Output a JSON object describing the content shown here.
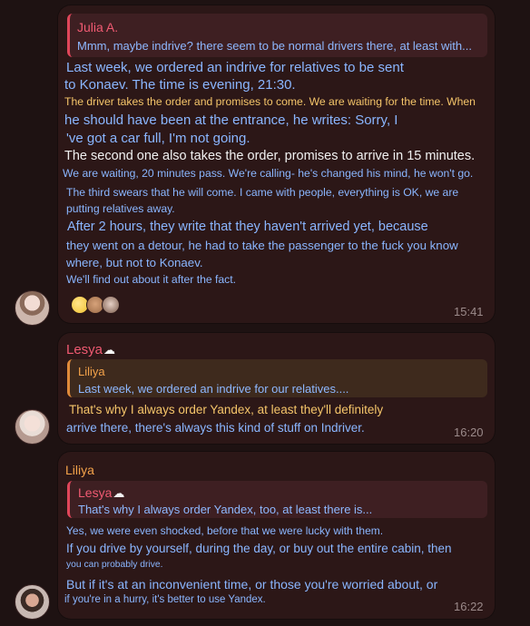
{
  "messages": [
    {
      "reply": {
        "author": "Julia A.",
        "text": "Mmm, maybe indrive? there seem to be normal drivers there, at least with..."
      },
      "lines": [
        "Last week, we ordered an indrive for relatives to be sent",
        "to Konaev. The time is evening, 21:30.",
        "The driver takes the order and promises to come. We are waiting for the time. When",
        "he should have been at the entrance, he writes: Sorry, I",
        "'ve got a car full, I'm not going.",
        "The second one also takes the order, promises to arrive in 15 minutes.",
        "We are waiting, 20 minutes pass. We're calling- he's changed his mind, he won't go.",
        "The third swears that he will come. I came with people, everything is OK, we are",
        "putting relatives away.",
        "After 2 hours, they write that they haven't arrived yet, because",
        "they went on a detour, he had to take the passenger to the fuck you know",
        "where, but not to Konaev.",
        "We'll find out about it after the fact."
      ],
      "reactions": [
        "slightly-smiling-face-icon",
        "dog-avatar-icon",
        "user-avatar-icon"
      ],
      "time": "15:41"
    },
    {
      "sender": "Lesya",
      "sender_emoji": "☁",
      "reply": {
        "author": "Liliya",
        "text": "Last week, we ordered an indrive for our relatives...."
      },
      "lines": [
        "That's why I always order Yandex, at least they'll definitely",
        "arrive there, there's always this kind of stuff on Indriver."
      ],
      "time": "16:20"
    },
    {
      "sender": "Liliya",
      "reply": {
        "author": "Lesya",
        "author_emoji": "☁",
        "text": "That's why I always order Yandex, too, at least there is..."
      },
      "lines": [
        "Yes, we were even shocked, before that we were lucky with them.",
        "If you drive by yourself, during the day, or buy out the entire cabin, then",
        "you can probably drive.",
        "But if it's at an inconvenient time, or those you're worried about, or",
        "if you're in a hurry, it's better to use Yandex."
      ],
      "time": "16:22"
    }
  ],
  "colors": {
    "background": "#1e1212",
    "bubble": "#2c1717",
    "accent_red": "#e0465a",
    "accent_orange": "#e08a3a",
    "text_blue": "#8ab6ff",
    "text_yellow": "#f5c56a",
    "text_white": "#f1f1f1",
    "time": "#9b8a8a"
  }
}
